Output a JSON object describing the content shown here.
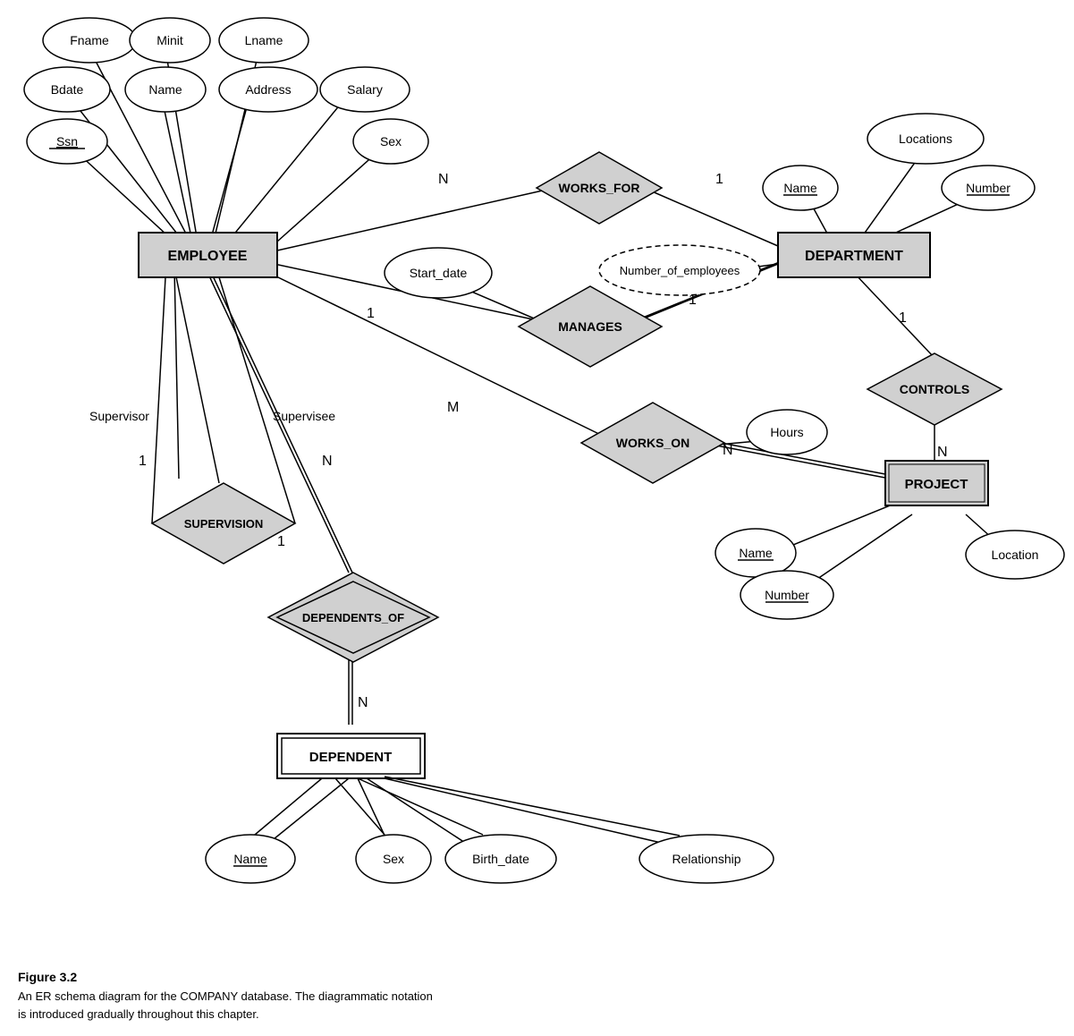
{
  "caption": {
    "title": "Figure 3.2",
    "line1": "An ER schema diagram for the COMPANY database. The diagrammatic notation",
    "line2": "is introduced gradually throughout this chapter."
  },
  "entities": {
    "employee": "EMPLOYEE",
    "department": "DEPARTMENT",
    "project": "PROJECT",
    "dependent": "DEPENDENT"
  },
  "relationships": {
    "works_for": "WORKS_FOR",
    "manages": "MANAGES",
    "works_on": "WORKS_ON",
    "controls": "CONTROLS",
    "supervision": "SUPERVISION",
    "dependents_of": "DEPENDENTS_OF"
  },
  "attributes": {
    "fname": "Fname",
    "minit": "Minit",
    "lname": "Lname",
    "bdate": "Bdate",
    "name": "Name",
    "address": "Address",
    "salary": "Salary",
    "ssn": "Ssn",
    "sex_employee": "Sex",
    "start_date": "Start_date",
    "number_of_employees": "Number_of_employees",
    "locations": "Locations",
    "dept_name": "Name",
    "dept_number": "Number",
    "hours": "Hours",
    "project_name": "Name",
    "project_number": "Number",
    "project_location": "Location",
    "dep_name": "Name",
    "dep_sex": "Sex",
    "dep_birth_date": "Birth_date",
    "dep_relationship": "Relationship"
  }
}
